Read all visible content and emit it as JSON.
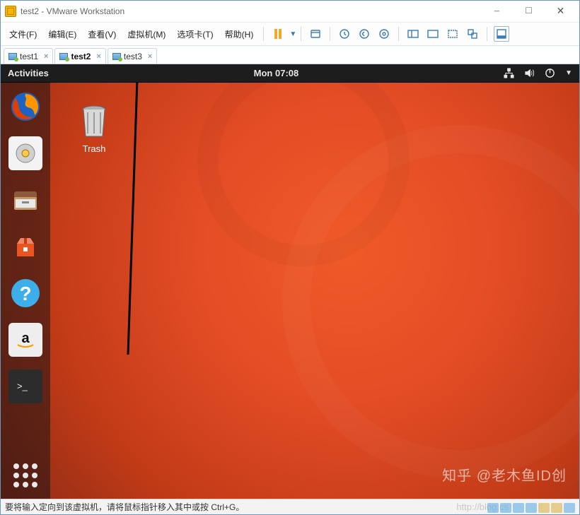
{
  "window": {
    "title": "test2 - VMware Workstation"
  },
  "menu": {
    "file": "文件(F)",
    "edit": "编辑(E)",
    "view": "查看(V)",
    "vm": "虚拟机(M)",
    "tabs": "选项卡(T)",
    "help": "帮助(H)"
  },
  "tabs": [
    {
      "label": "test1",
      "active": false
    },
    {
      "label": "test2",
      "active": true
    },
    {
      "label": "test3",
      "active": false
    }
  ],
  "gnome": {
    "activities": "Activities",
    "clock": "Mon 07:08"
  },
  "desktop": {
    "trash_label": "Trash"
  },
  "statusbar": {
    "hint": "要将输入定向到该虚拟机，请将鼠标指针移入其中或按 Ctrl+G。"
  },
  "watermark": {
    "main": "知乎 @老木鱼ID创",
    "url": "http://blog.cs"
  }
}
